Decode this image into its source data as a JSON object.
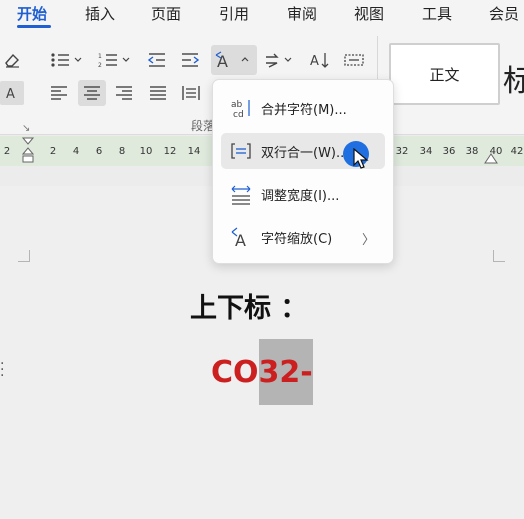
{
  "menubar": {
    "items": [
      "开始",
      "插入",
      "页面",
      "引用",
      "审阅",
      "视图",
      "工具",
      "会员"
    ]
  },
  "ribbon": {
    "group_label": "段落",
    "style_normal": "正文",
    "style_next_glyph": "标"
  },
  "ruler": {
    "ticks": [
      "2",
      "2",
      "4",
      "6",
      "8",
      "10",
      "12",
      "14",
      "32",
      "34",
      "36",
      "38",
      "40",
      "42"
    ]
  },
  "document": {
    "heading": "上下标 ：",
    "formula_plain": "CO",
    "formula_selected": "32-"
  },
  "dropdown": {
    "items": [
      {
        "label": "合并字符(M)...",
        "icon": "combine-characters-icon"
      },
      {
        "label": "双行合一(W)...",
        "icon": "two-lines-in-one-icon"
      },
      {
        "label": "调整宽度(I)...",
        "icon": "adjust-width-icon"
      },
      {
        "label": "字符缩放(C)",
        "icon": "character-scale-icon",
        "submenu": "〉"
      }
    ]
  },
  "colors": {
    "accent": "#1f5fd1",
    "formula": "#cc1f1f",
    "ruler": "#dfe9dc",
    "cursor": "#1f6fe0"
  }
}
